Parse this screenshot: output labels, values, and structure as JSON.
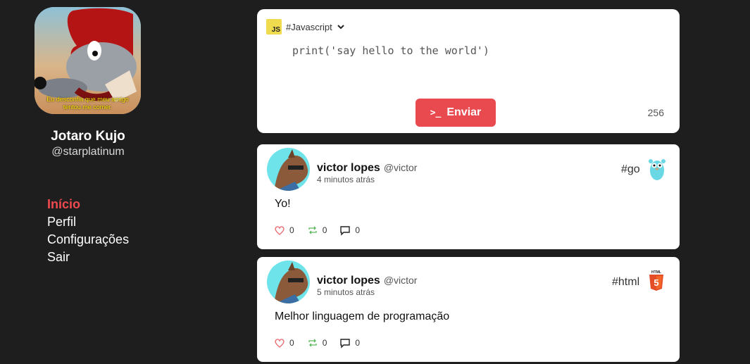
{
  "profile": {
    "avatar_caption_line1": "Eu desconfia que meu amigo",
    "avatar_caption_line2": "tentou me comer.",
    "name": "Jotaro Kujo",
    "handle": "@starplatinum"
  },
  "nav": {
    "home": "Início",
    "profile": "Perfil",
    "settings": "Configurações",
    "logout": "Sair"
  },
  "composer": {
    "language": "#Javascript",
    "language_icon": "javascript-icon",
    "code": "print('say hello to the world')",
    "send_label": "Enviar",
    "char_count": "256"
  },
  "posts": [
    {
      "author_name": "victor lopes",
      "author_handle": "@victor",
      "time": "4 minutos atrás",
      "tag": "#go",
      "tag_icon": "go-gopher-icon",
      "text": "Yo!",
      "likes": "0",
      "reposts": "0",
      "comments": "0"
    },
    {
      "author_name": "victor lopes",
      "author_handle": "@victor",
      "time": "5 minutos atrás",
      "tag": "#html",
      "tag_icon": "html5-icon",
      "text": "Melhor linguagem de programação",
      "likes": "0",
      "reposts": "0",
      "comments": "0"
    }
  ],
  "colors": {
    "background": "#1e1e1e",
    "accent": "#e84a50",
    "card": "#ffffff"
  }
}
